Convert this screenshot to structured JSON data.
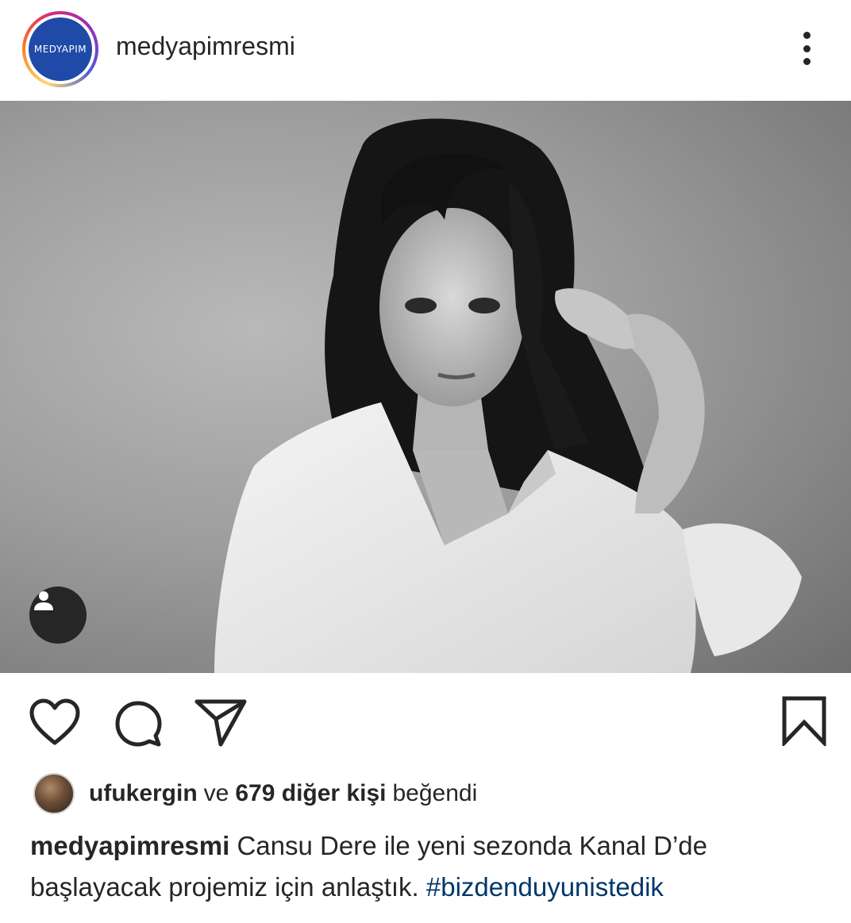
{
  "post": {
    "avatar_text": "MEDYAPIM",
    "username": "medyapimresmi"
  },
  "likes": {
    "liker": "ufukergin",
    "connector": "ve",
    "others": "679 diğer kişi",
    "suffix": "beğendi"
  },
  "caption": {
    "username": "medyapimresmi",
    "text": "Cansu Dere ile yeni sezonda Kanal D’de başlayacak projemiz için anlaştık.",
    "hashtag": "#bizdenduyunistedik"
  },
  "icons": {
    "more": "more-vertical-icon",
    "tag": "user-tag-icon",
    "like": "heart-icon",
    "comment": "comment-icon",
    "share": "send-icon",
    "save": "bookmark-icon"
  },
  "colors": {
    "text": "#262626",
    "hashtag": "#00376b",
    "avatar_bg": "#1f4aa8"
  }
}
